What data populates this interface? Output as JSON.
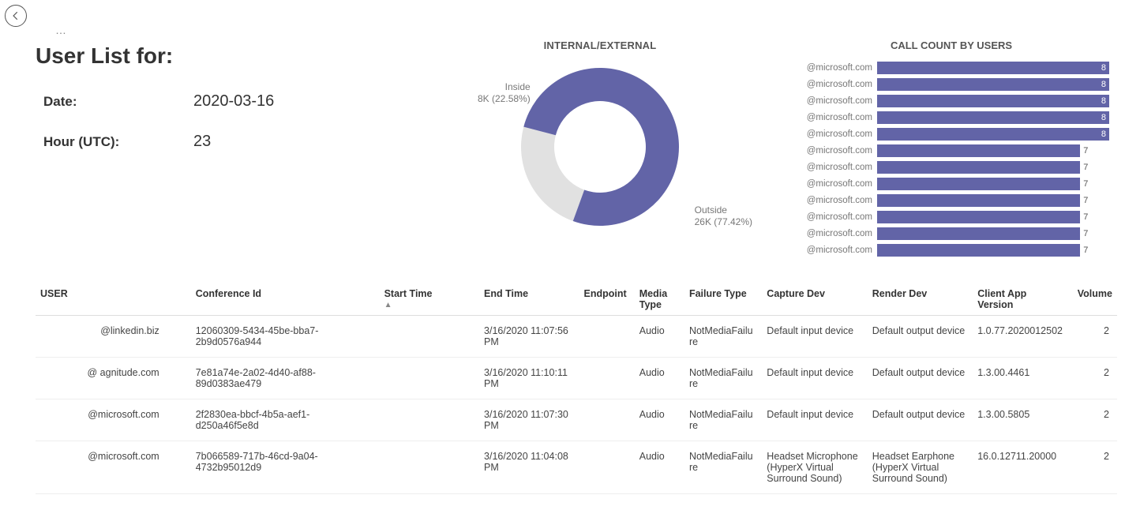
{
  "header": {
    "back_icon": "arrow-left",
    "title": "User List for:",
    "date_label": "Date:",
    "date_value": "2020-03-16",
    "hour_label": "Hour (UTC):",
    "hour_value": "23"
  },
  "chart_data": {
    "type": "pie",
    "title": "INTERNAL/EXTERNAL",
    "categories": [
      "Inside",
      "Outside"
    ],
    "values": [
      8000,
      26000
    ],
    "labels": [
      "Inside\n8K (22.58%)",
      "Outside\n26K (77.42%)"
    ],
    "colors": [
      "#e1e1e1",
      "#6264a7"
    ]
  },
  "call_count": {
    "title": "CALL COUNT BY USERS",
    "max": 8,
    "data": [
      {
        "user": "@microsoft.com",
        "count": 8
      },
      {
        "user": "@microsoft.com",
        "count": 8
      },
      {
        "user": "@microsoft.com",
        "count": 8
      },
      {
        "user": "@microsoft.com",
        "count": 8
      },
      {
        "user": "@microsoft.com",
        "count": 8
      },
      {
        "user": "@microsoft.com",
        "count": 7
      },
      {
        "user": "@microsoft.com",
        "count": 7
      },
      {
        "user": "@microsoft.com",
        "count": 7
      },
      {
        "user": "@microsoft.com",
        "count": 7
      },
      {
        "user": "@microsoft.com",
        "count": 7
      },
      {
        "user": "@microsoft.com",
        "count": 7
      },
      {
        "user": "@microsoft.com",
        "count": 7
      }
    ]
  },
  "table": {
    "columns": [
      "USER",
      "Conference Id",
      "Start Time",
      "End Time",
      "Endpoint",
      "Media Type",
      "Failure Type",
      "Capture Dev",
      "Render Dev",
      "Client App Version",
      "Volume"
    ],
    "sort_column": "Start Time",
    "sort_dir": "asc",
    "rows": [
      {
        "user": "@linkedin.biz",
        "conference_id": "12060309-5434-45be-bba7-2b9d0576a944",
        "start_time": "",
        "end_time": "3/16/2020 11:07:56 PM",
        "endpoint": "",
        "media_type": "Audio",
        "failure_type": "NotMediaFailure",
        "capture_dev": "Default input device",
        "render_dev": "Default output device",
        "client_app_version": "1.0.77.2020012502",
        "volume": 2
      },
      {
        "user": "@        agnitude.com",
        "conference_id": "7e81a74e-2a02-4d40-af88-89d0383ae479",
        "start_time": "",
        "end_time": "3/16/2020 11:10:11 PM",
        "endpoint": "",
        "media_type": "Audio",
        "failure_type": "NotMediaFailure",
        "capture_dev": "Default input device",
        "render_dev": "Default output device",
        "client_app_version": "1.3.00.4461",
        "volume": 2
      },
      {
        "user": "@microsoft.com",
        "conference_id": "2f2830ea-bbcf-4b5a-aef1-d250a46f5e8d",
        "start_time": "",
        "end_time": "3/16/2020 11:07:30 PM",
        "endpoint": "",
        "media_type": "Audio",
        "failure_type": "NotMediaFailure",
        "capture_dev": "Default input device",
        "render_dev": "Default output device",
        "client_app_version": "1.3.00.5805",
        "volume": 2
      },
      {
        "user": "@microsoft.com",
        "conference_id": "7b066589-717b-46cd-9a04-4732b95012d9",
        "start_time": "",
        "end_time": "3/16/2020 11:04:08 PM",
        "endpoint": "",
        "media_type": "Audio",
        "failure_type": "NotMediaFailure",
        "capture_dev": "Headset Microphone (HyperX Virtual Surround Sound)",
        "render_dev": "Headset Earphone (HyperX Virtual Surround Sound)",
        "client_app_version": "16.0.12711.20000",
        "volume": 2
      }
    ]
  }
}
